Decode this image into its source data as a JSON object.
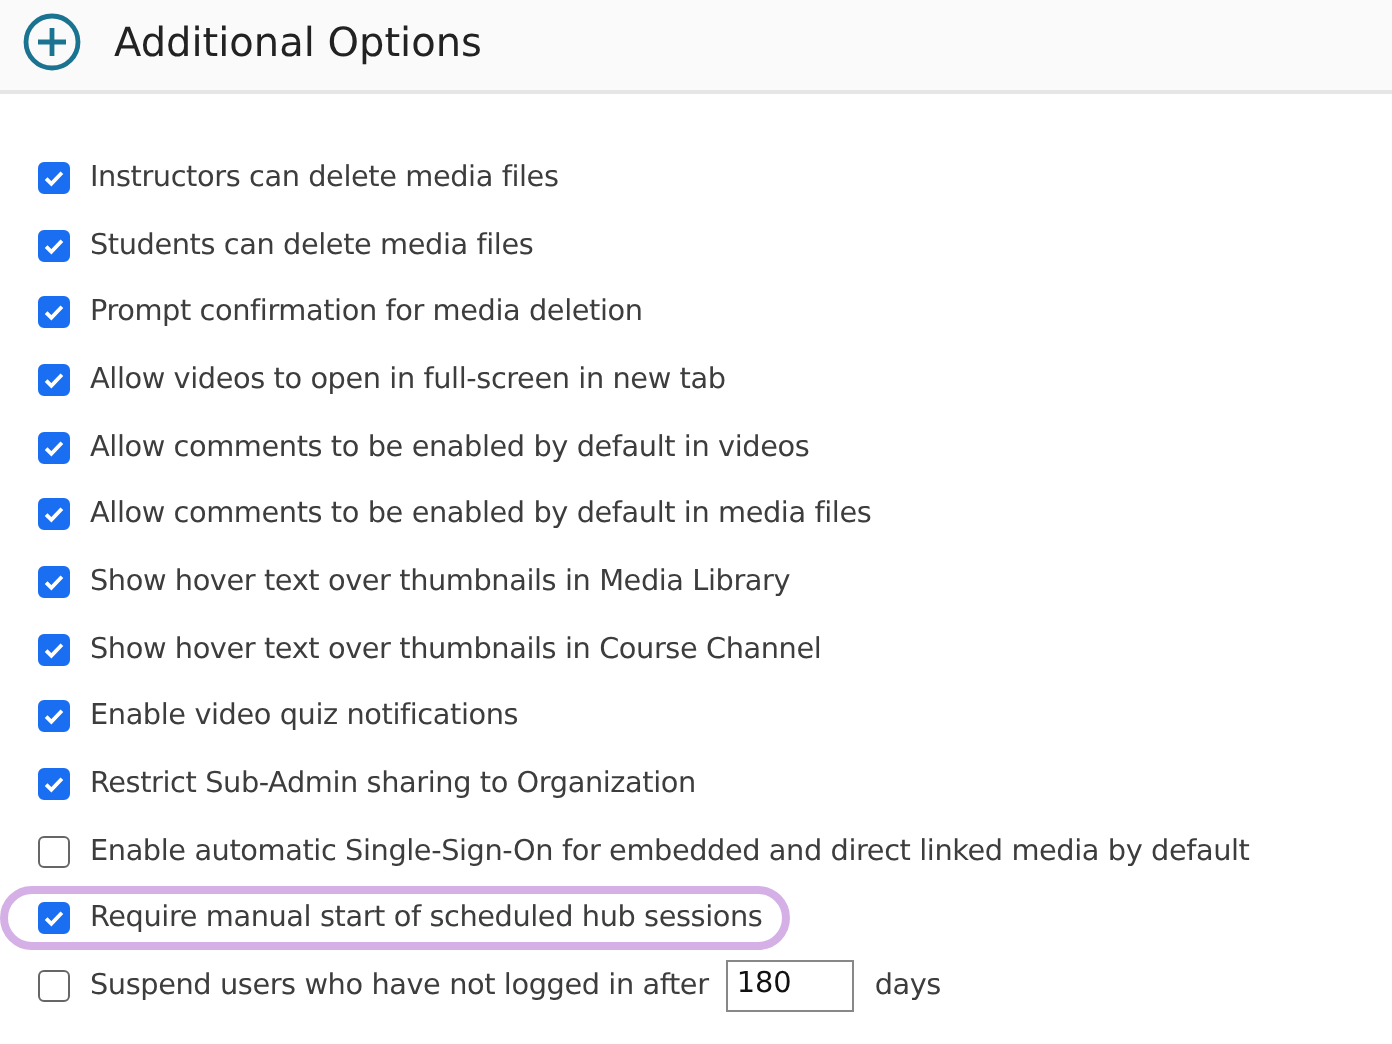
{
  "section": {
    "title": "Additional Options",
    "expanded": false
  },
  "options": [
    {
      "kind": "checkbox",
      "label": "Instructors can delete media files",
      "checked": true,
      "highlighted": false
    },
    {
      "kind": "checkbox",
      "label": "Students can delete media files",
      "checked": true,
      "highlighted": false
    },
    {
      "kind": "checkbox",
      "label": "Prompt confirmation for media deletion",
      "checked": true,
      "highlighted": false
    },
    {
      "kind": "checkbox",
      "label": "Allow videos to open in full-screen in new tab",
      "checked": true,
      "highlighted": false
    },
    {
      "kind": "checkbox",
      "label": "Allow comments to be enabled by default in videos",
      "checked": true,
      "highlighted": false
    },
    {
      "kind": "checkbox",
      "label": "Allow comments to be enabled by default in media files",
      "checked": true,
      "highlighted": false
    },
    {
      "kind": "checkbox",
      "label": "Show hover text over thumbnails in Media Library",
      "checked": true,
      "highlighted": false
    },
    {
      "kind": "checkbox",
      "label": "Show hover text over thumbnails in Course Channel",
      "checked": true,
      "highlighted": false
    },
    {
      "kind": "checkbox",
      "label": "Enable video quiz notifications",
      "checked": true,
      "highlighted": false
    },
    {
      "kind": "checkbox",
      "label": "Restrict Sub-Admin sharing to Organization",
      "checked": true,
      "highlighted": false
    },
    {
      "kind": "checkbox",
      "label": "Enable automatic Single-Sign-On for embedded and direct linked media by default",
      "checked": false,
      "highlighted": false
    },
    {
      "kind": "checkbox",
      "label": "Require manual start of scheduled hub sessions",
      "checked": true,
      "highlighted": true
    },
    {
      "kind": "checkbox-input",
      "label": "Suspend users who have not logged in after",
      "value": "180",
      "suffix": "days",
      "checked": false,
      "highlighted": false
    }
  ]
}
